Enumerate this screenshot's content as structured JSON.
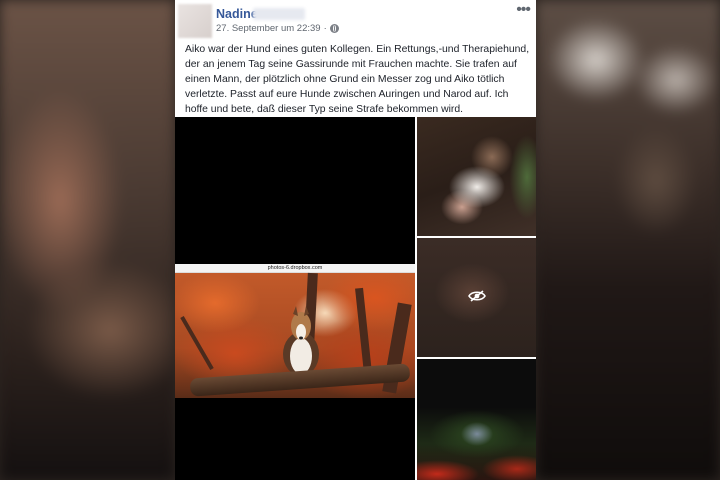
{
  "post": {
    "author": "Nadine",
    "timestamp": "27. September um 22:39",
    "separator": "·",
    "privacy_icon": "globe-icon",
    "more_icon": "more-options-icon",
    "text": "Aiko war der Hund eines guten Kollegen. Ein Rettungs,-und Therapiehund, der an jenem Tag seine Gassirunde mit Frauchen machte. Sie trafen auf einen Mann, der plötzlich ohne Grund ein Messer zog und Aiko tötlich verletzte. Passt auf eure Hunde zwischen Auringen und Narod auf. Ich hoffe und bete, daß dieser Typ seine Strafe bekommen wird."
  },
  "photos": {
    "main_url": "photos-6.dropbox.com",
    "hidden_icon": "eye-slash-icon"
  },
  "colors": {
    "author_link": "#365899",
    "meta_text": "#606770",
    "body_text": "#1d2129"
  }
}
